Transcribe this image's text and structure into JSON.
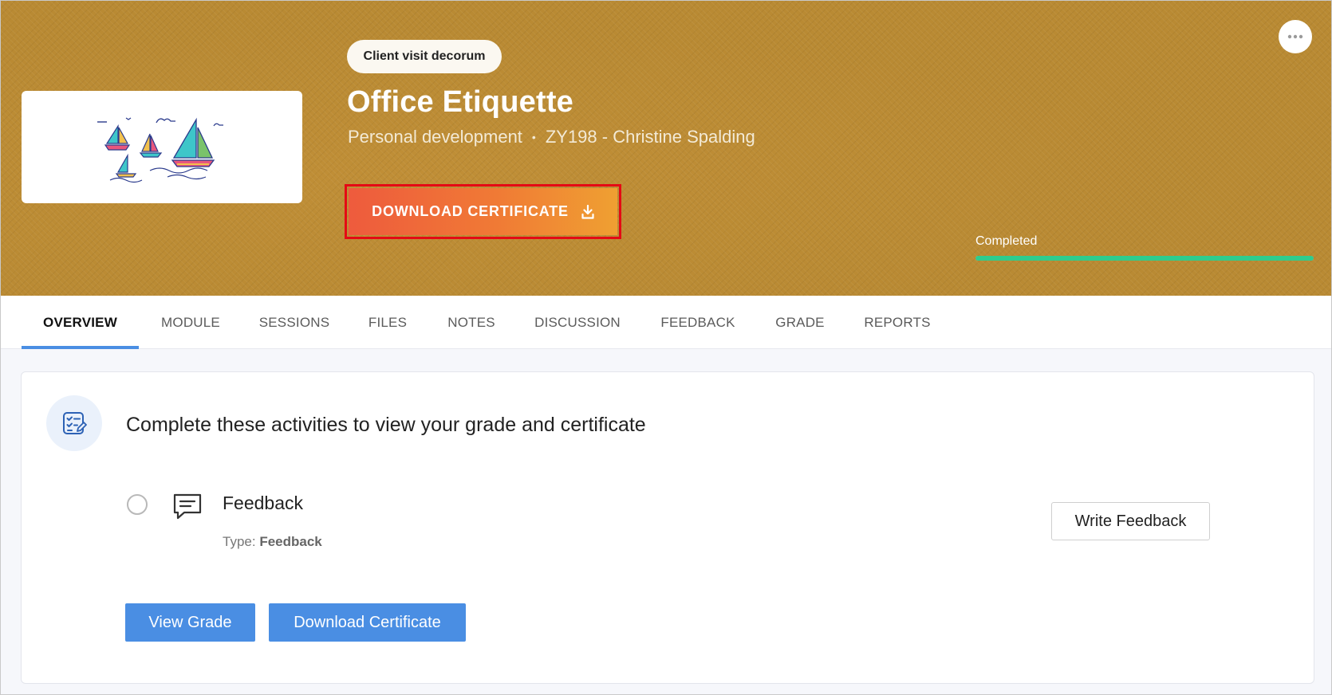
{
  "hero": {
    "tag": "Client visit decorum",
    "title": "Office Etiquette",
    "category": "Personal development",
    "course_code": "ZY198 - Christine Spalding",
    "download_certificate_label": "DOWNLOAD CERTIFICATE",
    "download_icon": "download-icon",
    "more_icon": "more-horizontal-icon",
    "progress_label": "Completed",
    "progress_percent": 100,
    "progress_color": "#2ecc8e",
    "highlight_color": "#e50914"
  },
  "tabs": [
    {
      "label": "OVERVIEW",
      "active": true
    },
    {
      "label": "MODULE",
      "active": false
    },
    {
      "label": "SESSIONS",
      "active": false
    },
    {
      "label": "FILES",
      "active": false
    },
    {
      "label": "NOTES",
      "active": false
    },
    {
      "label": "DISCUSSION",
      "active": false
    },
    {
      "label": "FEEDBACK",
      "active": false
    },
    {
      "label": "GRADE",
      "active": false
    },
    {
      "label": "REPORTS",
      "active": false
    }
  ],
  "overview": {
    "heading": "Complete these activities to view your grade and certificate",
    "heading_icon": "checklist-icon",
    "activities": [
      {
        "name": "Feedback",
        "icon": "message-icon",
        "type_label": "Type:",
        "type_value": "Feedback",
        "action_label": "Write Feedback"
      }
    ],
    "view_grade_label": "View Grade",
    "download_certificate_label": "Download Certificate",
    "accent_color": "#4a8ee3"
  }
}
